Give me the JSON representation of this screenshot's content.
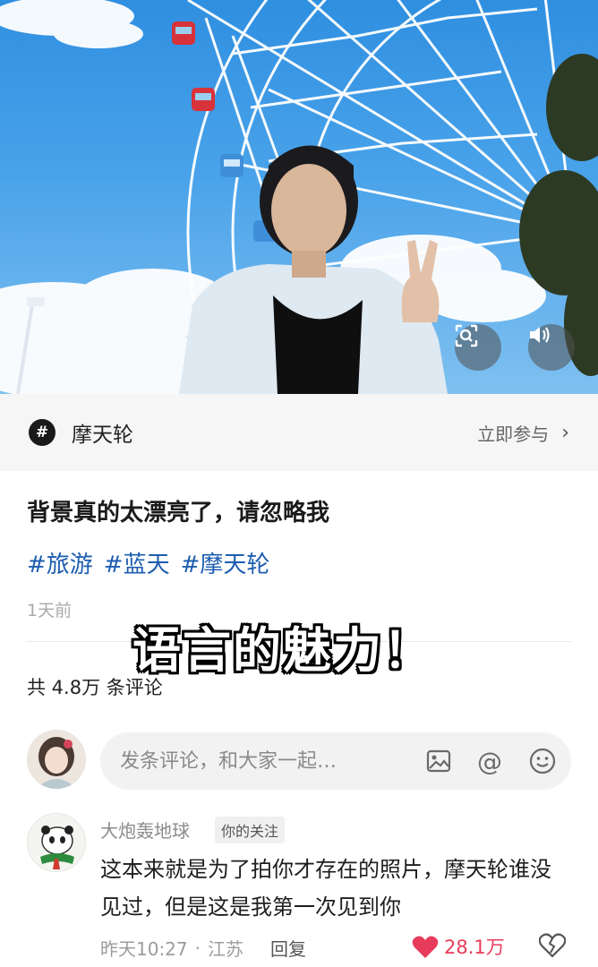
{
  "topic": {
    "icon_glyph": "#",
    "name": "摩天轮",
    "join_label": "立即参与",
    "chevron": "›"
  },
  "post": {
    "title": "背景真的太漂亮了，请忽略我",
    "tags": [
      "#旅游",
      "#蓝天",
      "#摩天轮"
    ],
    "time": "1天前",
    "overlay_caption": "语言的魅力！",
    "comment_count_label": "共 4.8万 条评论"
  },
  "comment_input": {
    "placeholder": "发条评论，和大家一起…",
    "icons": [
      "image-icon",
      "at-icon",
      "emoji-icon"
    ],
    "at_glyph": "@"
  },
  "comment": {
    "username": "大炮轰地球",
    "badge": "你的关注",
    "text": "这本来就是为了拍你才存在的照片，摩天轮谁没见过，但是这是我第一次见到你",
    "time": "昨天10:27",
    "separator": "·",
    "location": "江苏",
    "reply_label": "回复",
    "like_count": "28.1万"
  },
  "colors": {
    "accent_tag": "#1d5db0",
    "like": "#e83a5a",
    "sky": "#2f8fe0"
  }
}
